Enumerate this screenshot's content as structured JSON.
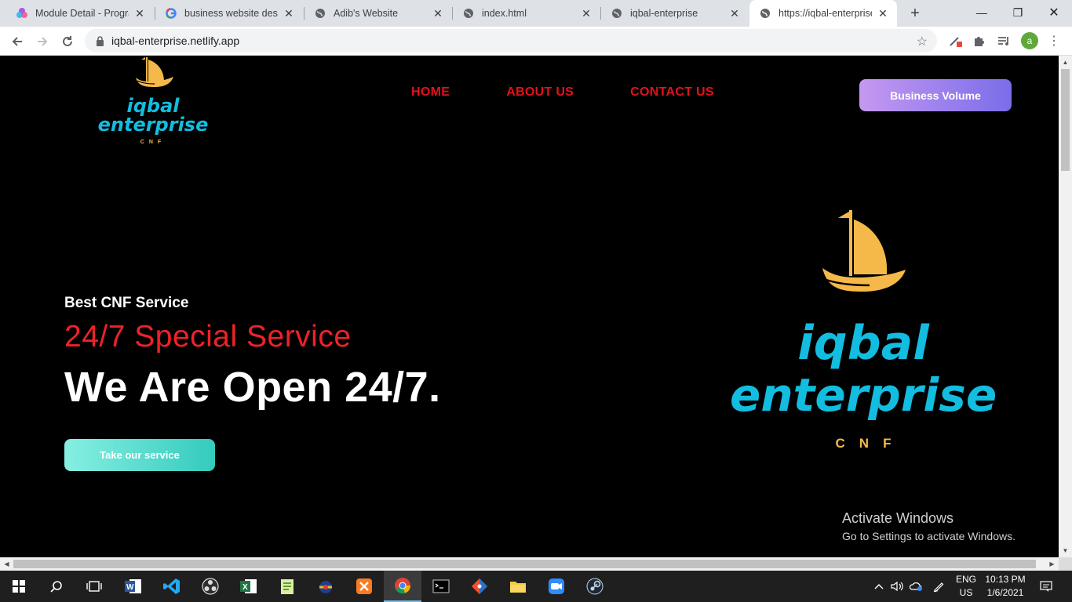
{
  "browser": {
    "tabs": [
      {
        "title": "Module Detail - Progra",
        "icon": "pinwheel-icon"
      },
      {
        "title": "business website design",
        "icon": "google-icon"
      },
      {
        "title": "Adib's Website",
        "icon": "globe-icon"
      },
      {
        "title": "index.html",
        "icon": "globe-icon"
      },
      {
        "title": "iqbal-enterprise",
        "icon": "globe-icon"
      },
      {
        "title": "https://iqbal-enterprise",
        "icon": "globe-icon",
        "active": true
      }
    ],
    "url": "iqbal-enterprise.netlify.app"
  },
  "site": {
    "logo_word1": "iqbal",
    "logo_word2": "enterprise",
    "logo_sub": "CNF",
    "menu": [
      "HOME",
      "ABOUT US",
      "CONTACT US"
    ],
    "business_button": "Business Volume",
    "hero": {
      "kicker": "Best CNF Service",
      "special": "24/7 Special Service",
      "title": "We Are Open 24/7.",
      "cta": "Take our service"
    }
  },
  "watermark": {
    "line1": "Activate Windows",
    "line2": "Go to Settings to activate Windows."
  },
  "taskbar": {
    "apps": [
      "start-icon",
      "search-icon",
      "task-view-icon",
      "word-icon",
      "vscode-icon",
      "obs-icon",
      "excel-icon",
      "notepad-icon",
      "app-icon",
      "xampp-icon",
      "chrome-icon",
      "terminal-icon",
      "git-icon",
      "explorer-icon",
      "zoom-icon",
      "steam-icon"
    ],
    "lang1": "ENG",
    "lang2": "US",
    "time": "10:13 PM",
    "date": "1/6/2021"
  },
  "colors": {
    "menu": "#e3121b",
    "logo_blue": "#12bde0",
    "logo_gold": "#f5b94a"
  }
}
